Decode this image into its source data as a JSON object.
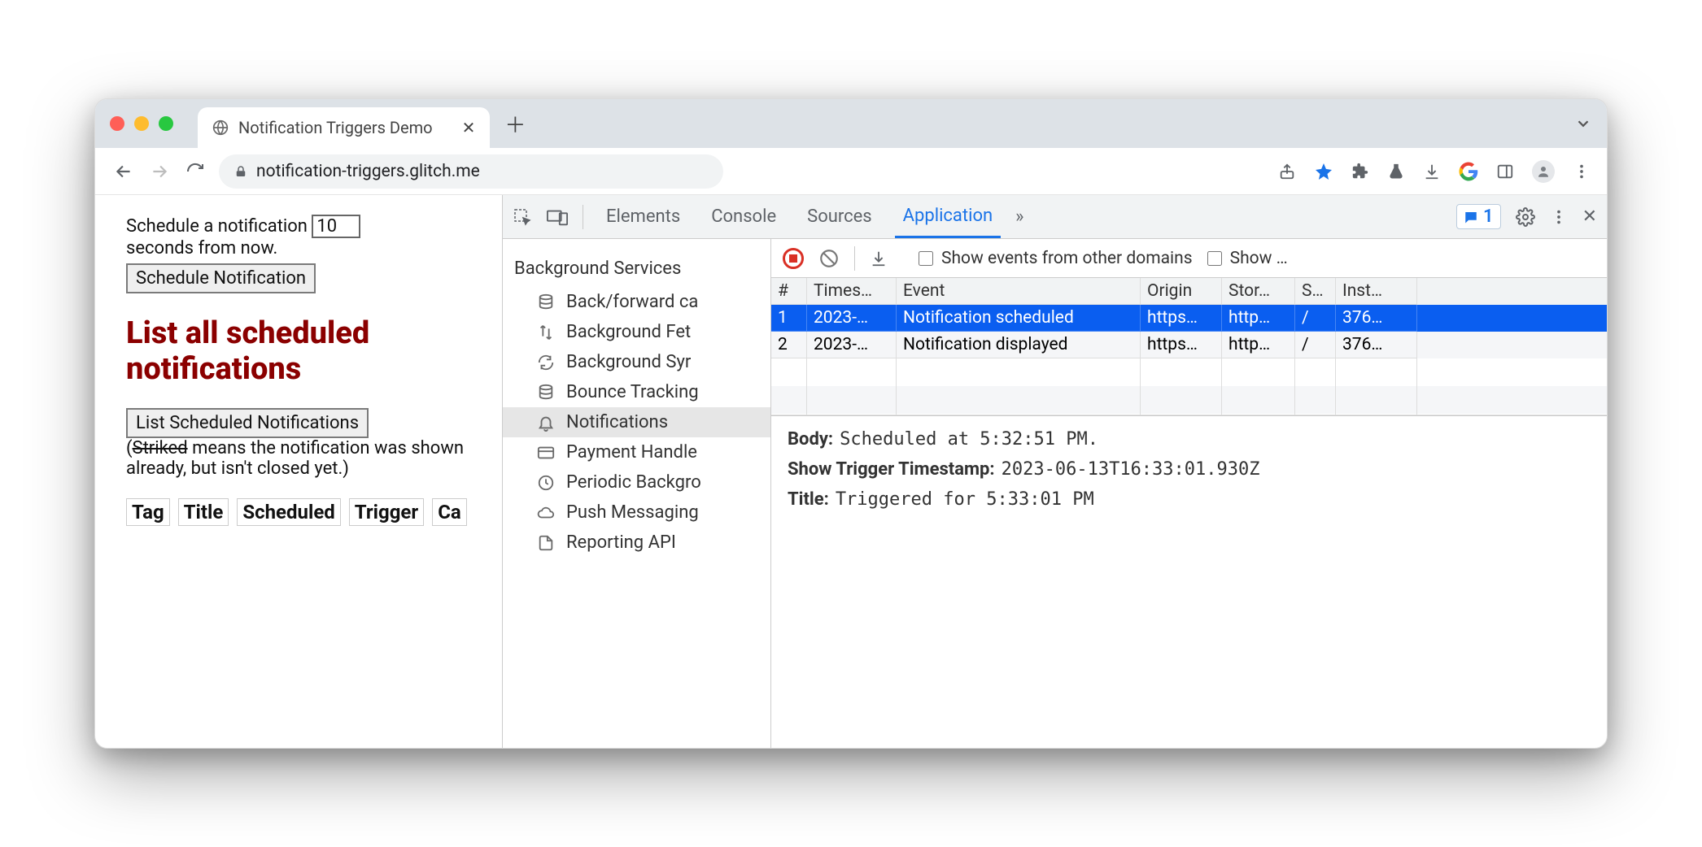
{
  "window": {
    "tab_title": "Notification Triggers Demo",
    "url": "notification-triggers.glitch.me"
  },
  "page": {
    "line1a": "Schedule a notification ",
    "seconds_value": "10",
    "line1b": " seconds from now.",
    "schedule_btn": "Schedule Notification",
    "heading": "List all scheduled notifications",
    "list_btn": "List Scheduled Notifications",
    "note_open": "(",
    "note_striked": "Striked",
    "note_rest": " means the notification was shown already, but isn't closed yet.)",
    "table_headers": [
      "Tag",
      "Title",
      "Scheduled",
      "Trigger",
      "Ca"
    ]
  },
  "devtools": {
    "tabs": [
      "Elements",
      "Console",
      "Sources",
      "Application"
    ],
    "more": "»",
    "badge_count": "1",
    "sidebar_title": "Background Services",
    "sidebar_items": [
      "Back/forward ca",
      "Background Fet",
      "Background Syr",
      "Bounce Tracking",
      "Notifications",
      "Payment Handle",
      "Periodic Backgro",
      "Push Messaging",
      "Reporting API"
    ],
    "toolbar": {
      "show_other": "Show events from other domains",
      "show_trunc": "Show …"
    },
    "columns": [
      "#",
      "Times…",
      "Event",
      "Origin",
      "Stor…",
      "S…",
      "Inst…"
    ],
    "rows": [
      {
        "n": "1",
        "ts": "2023-…",
        "event": "Notification scheduled",
        "origin": "https…",
        "stor": "http…",
        "s": "/",
        "inst": "376…"
      },
      {
        "n": "2",
        "ts": "2023-…",
        "event": "Notification displayed",
        "origin": "https…",
        "stor": "http…",
        "s": "/",
        "inst": "376…"
      }
    ],
    "details": {
      "body_label": "Body:",
      "body_value": "Scheduled at 5:32:51 PM.",
      "ts_label": "Show Trigger Timestamp:",
      "ts_value": "2023-06-13T16:33:01.930Z",
      "title_label": "Title:",
      "title_value": "Triggered for 5:33:01 PM"
    }
  }
}
